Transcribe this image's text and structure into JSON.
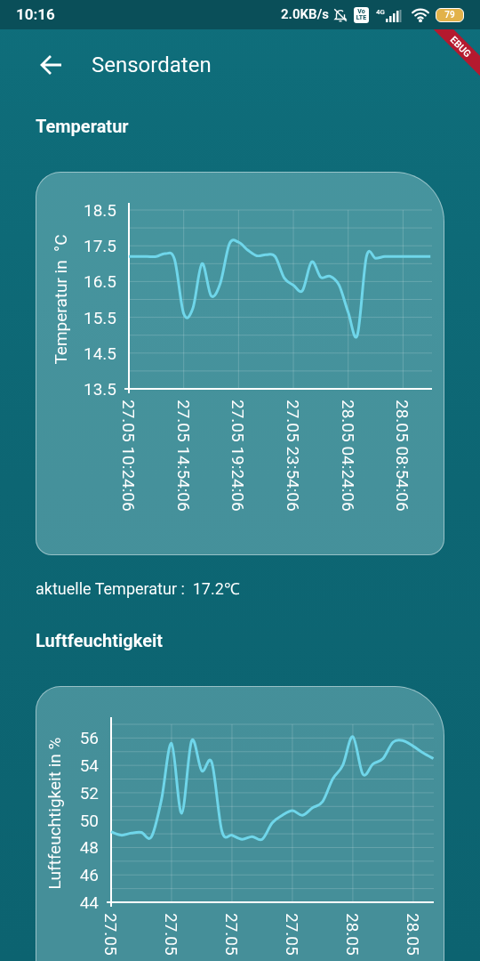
{
  "status_bar": {
    "time": "10:16",
    "network_speed": "2.0KB/s",
    "volte_top": "Vo",
    "volte_bottom": "LTE",
    "network_type": "4G",
    "battery": "79"
  },
  "debug_banner": "EBUG",
  "app_bar": {
    "title": "Sensordaten"
  },
  "sections": [
    {
      "title": "Temperatur",
      "chart_data": {
        "type": "line",
        "grid": true,
        "ylabel": "Temperatur in  °C",
        "ylim": [
          13.5,
          18.5
        ],
        "yticks": [
          13.5,
          14.5,
          15.5,
          16.5,
          17.5,
          18.5
        ],
        "categories": [
          "27.05 10:24:06",
          null,
          null,
          null,
          null,
          null,
          "27.05 14:54:06",
          null,
          null,
          null,
          null,
          null,
          "27.05 19:24:06",
          null,
          null,
          null,
          null,
          null,
          "27.05 23:54:06",
          null,
          null,
          null,
          null,
          null,
          "28.05 04:24:06",
          null,
          null,
          null,
          null,
          null,
          "28.05 08:54:06",
          null,
          null,
          null
        ],
        "series": [
          {
            "color": "#6fd6ea",
            "values": [
              17.2,
              17.2,
              17.2,
              17.2,
              17.28,
              17.12,
              15.6,
              15.75,
              17.0,
              16.1,
              16.45,
              17.55,
              17.6,
              17.38,
              17.22,
              17.25,
              17.2,
              16.6,
              16.4,
              16.25,
              17.05,
              16.62,
              16.65,
              16.4,
              15.64,
              15.0,
              17.2,
              17.15,
              17.2,
              17.2,
              17.2,
              17.2,
              17.2,
              17.2
            ]
          }
        ]
      },
      "reading": "aktuelle Temperatur :  17.2℃"
    },
    {
      "title": "Luftfeuchtigkeit",
      "chart_data": {
        "type": "line",
        "grid": true,
        "ylabel": "Luftfeuchtigkeit in %",
        "ylim": [
          44,
          57
        ],
        "yticks": [
          44,
          46,
          48,
          50,
          52,
          54,
          56
        ],
        "categories": [
          "27.05",
          null,
          null,
          null,
          null,
          null,
          "27.05",
          null,
          null,
          null,
          null,
          null,
          "27.05",
          null,
          null,
          null,
          null,
          null,
          "27.05",
          null,
          null,
          null,
          null,
          null,
          "28.05",
          null,
          null,
          null,
          null,
          null,
          "28.05",
          null,
          null
        ],
        "series": [
          {
            "color": "#6fd6ea",
            "values": [
              49.15,
              48.9,
              49.05,
              49.1,
              48.78,
              51.5,
              55.6,
              50.5,
              55.8,
              53.6,
              54.2,
              49.2,
              48.9,
              48.6,
              48.8,
              48.6,
              49.8,
              50.35,
              50.7,
              50.35,
              50.9,
              51.35,
              53.0,
              54.0,
              56.1,
              53.35,
              54.1,
              54.5,
              55.7,
              55.8,
              55.4,
              54.9,
              54.5
            ]
          }
        ]
      }
    }
  ]
}
